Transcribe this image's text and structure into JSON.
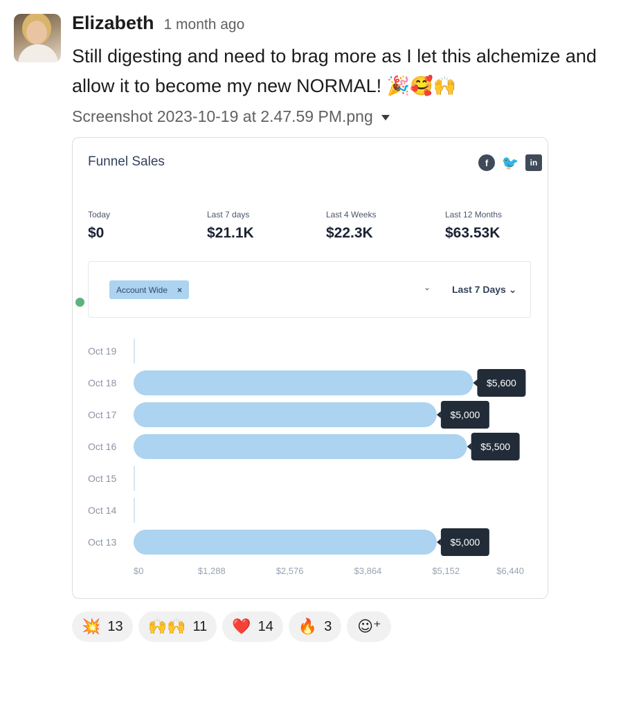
{
  "message": {
    "author": "Elizabeth",
    "timestamp": "1 month ago",
    "text": "Still digesting and need to brag more as I let this alchemize and allow it to become my new NORMAL!",
    "text_emojis": "🎉🥰🙌",
    "attachment_name": "Screenshot 2023-10-19 at 2.47.59 PM.png"
  },
  "widget": {
    "title": "Funnel Sales",
    "social_icons": [
      "facebook-icon",
      "twitter-icon",
      "linkedin-icon"
    ],
    "stats": [
      {
        "label": "Today",
        "value": "$0"
      },
      {
        "label": "Last 7 days",
        "value": "$21.1K"
      },
      {
        "label": "Last 4 Weeks",
        "value": "$22.3K"
      },
      {
        "label": "Last 12 Months",
        "value": "$63.53K"
      }
    ],
    "filter_tag": "Account Wide",
    "filter_tag_remove": "×",
    "range_label": "Last 7 Days",
    "range_caret": "⌄",
    "select_caret": "⌄"
  },
  "chart_data": {
    "type": "bar",
    "orientation": "horizontal",
    "categories": [
      "Oct 19",
      "Oct 18",
      "Oct 17",
      "Oct 16",
      "Oct 15",
      "Oct 14",
      "Oct 13"
    ],
    "values": [
      0,
      5600,
      5000,
      5500,
      0,
      0,
      5000
    ],
    "data_labels": [
      "",
      "$5,600",
      "$5,000",
      "$5,500",
      "",
      "",
      "$5,000"
    ],
    "x_ticks": [
      0,
      1288,
      2576,
      3864,
      5152,
      6440
    ],
    "x_tick_labels": [
      "$0",
      "$1,288",
      "$2,576",
      "$3,864",
      "$5,152",
      "$6,440"
    ],
    "xlim": [
      0,
      6440
    ],
    "bar_color": "#acd3f0",
    "label_bg": "#222b38",
    "grid": false,
    "title": "",
    "xlabel": "",
    "ylabel": ""
  },
  "reactions": [
    {
      "emoji": "💥",
      "icon": "collision-icon",
      "count": "13"
    },
    {
      "emoji": "🙌🙌",
      "icon": "raised-hands-icon",
      "count": "11"
    },
    {
      "emoji": "❤️",
      "icon": "heart-icon",
      "count": "14"
    },
    {
      "emoji": "🔥",
      "icon": "fire-icon",
      "count": "3"
    }
  ],
  "add_reaction_icon": "add-reaction-icon",
  "add_reaction_glyph": "☺⁺"
}
